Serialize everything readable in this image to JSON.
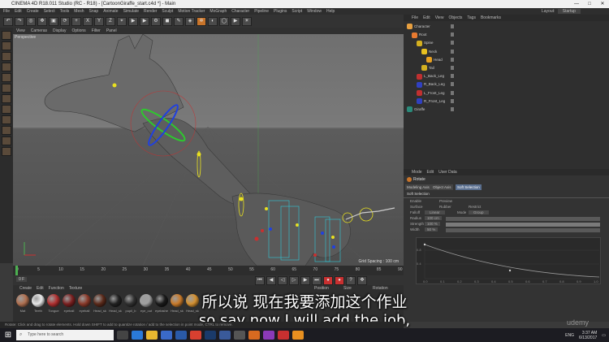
{
  "window": {
    "title": "CINEMA 4D R18.011 Studio (RC - R18) - [CartoonGiraffe_start.c4d *] - Main",
    "controls": [
      "—",
      "□",
      "✕"
    ]
  },
  "menubar": {
    "items": [
      "File",
      "Edit",
      "Create",
      "Select",
      "Tools",
      "Mesh",
      "Snap",
      "Animate",
      "Simulate",
      "Render",
      "Sculpt",
      "Motion Tracker",
      "MoGraph",
      "Character",
      "Pipeline",
      "Plugins",
      "Script",
      "Window",
      "Help"
    ],
    "layout_label": "Layout:",
    "layout_value": "Startup"
  },
  "toolbar": {
    "axis_buttons": [
      "X",
      "Y",
      "Z"
    ]
  },
  "viewport": {
    "menu": [
      "View",
      "Cameras",
      "Display",
      "Options",
      "Filter",
      "Panel"
    ],
    "label": "Perspective",
    "grid_spacing": "Grid Spacing : 100 cm"
  },
  "timeline": {
    "ticks": [
      "0",
      "5",
      "10",
      "15",
      "20",
      "25",
      "30",
      "35",
      "40",
      "45",
      "50",
      "55",
      "60",
      "65",
      "70",
      "75",
      "80",
      "85",
      "90"
    ],
    "current_frame": "0 F"
  },
  "material_manager": {
    "menu": [
      "Create",
      "Edit",
      "Function",
      "Texture"
    ],
    "materials": [
      {
        "name": "Mat",
        "color": "#b07050"
      },
      {
        "name": "Teeth",
        "color": "#e8e8e8"
      },
      {
        "name": "Tongue",
        "color": "#b03030"
      },
      {
        "name": "eyeball",
        "color": "#7a2020"
      },
      {
        "name": "eyeball",
        "color": "#8a3a2a"
      },
      {
        "name": "Head_sk",
        "color": "#5a2a1a"
      },
      {
        "name": "Head_sk",
        "color": "#222222"
      },
      {
        "name": "pupil_b",
        "color": "#303030"
      },
      {
        "name": "eye_out",
        "color": "#a0a0a0"
      },
      {
        "name": "eyelashe",
        "color": "#1a1a1a"
      },
      {
        "name": "Head_sk",
        "color": "#c87a2a"
      },
      {
        "name": "Head_sk",
        "color": "#d49030"
      }
    ]
  },
  "coords": {
    "headers": [
      "Position",
      "Size",
      "Rotation"
    ]
  },
  "object_manager": {
    "menu": [
      "File",
      "Edit",
      "View",
      "Objects",
      "Tags",
      "Bookmarks"
    ],
    "objects": [
      {
        "name": "Character",
        "color": "#e8a040",
        "indent": 0
      },
      {
        "name": "Root",
        "color": "#e87a30",
        "indent": 1
      },
      {
        "name": "Spine",
        "color": "#d4b020",
        "indent": 2
      },
      {
        "name": "Neck",
        "color": "#e8c020",
        "indent": 3
      },
      {
        "name": "Head",
        "color": "#e8a020",
        "indent": 4
      },
      {
        "name": "Tail",
        "color": "#d4b020",
        "indent": 3
      },
      {
        "name": "L_Back_Leg",
        "color": "#c03030",
        "indent": 2
      },
      {
        "name": "R_Back_Leg",
        "color": "#3040c0",
        "indent": 2
      },
      {
        "name": "L_Front_Leg",
        "color": "#c03030",
        "indent": 2
      },
      {
        "name": "R_Front_Leg",
        "color": "#3040c0",
        "indent": 2
      },
      {
        "name": "Giraffe",
        "color": "#2a8a7a",
        "indent": 0
      }
    ]
  },
  "attribute_manager": {
    "menu": [
      "Mode",
      "Edit",
      "User Data"
    ],
    "tool_name": "Rotate",
    "tabs": [
      "Modeling Axis",
      "Object Axis",
      "Soft Selection"
    ],
    "selected_tab": "Soft Selection",
    "section_title": "Soft Selection",
    "props": {
      "enable": "Enable",
      "preview": "Preview",
      "surface": "Surface",
      "rubber": "Rubber",
      "restrict": "Restrict",
      "falloff": "Falloff",
      "falloff_value": "Linear",
      "mode": "Mode",
      "mode_value": "Group",
      "radius": "Radius",
      "radius_value": "100 cm",
      "strength": "Strength",
      "strength_value": "100 %",
      "width": "Width",
      "width_value": "50 %"
    },
    "graph": {
      "y_ticks": [
        "0.8",
        "0.4"
      ],
      "x_ticks": [
        "0.0",
        "0.1",
        "0.2",
        "0.3",
        "0.4",
        "0.5",
        "0.6",
        "0.7",
        "0.8",
        "0.9",
        "1.0"
      ]
    }
  },
  "subtitles": {
    "chinese": "所以说 现在我要添加这个作业",
    "english": "so say now I will add the job,"
  },
  "statusbar": {
    "text": "Rotate: Click and drag to rotate elements. Hold down SHIFT to add to quantize rotation / add to the selection in point mode, CTRL to remove."
  },
  "taskbar": {
    "search_placeholder": "Type here to search",
    "lang": "ENG",
    "time": "3:37 AM",
    "date": "6/13/2017"
  },
  "watermark": "udemy"
}
